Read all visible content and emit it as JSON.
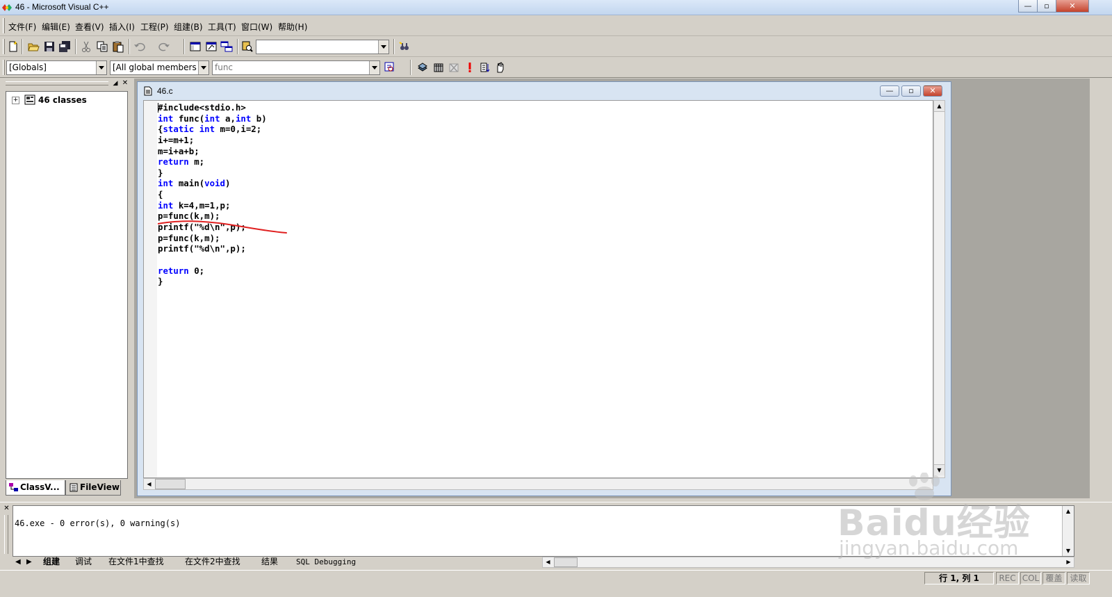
{
  "window": {
    "title": "46 - Microsoft Visual C++",
    "controls": {
      "minimize": "—",
      "maximize": "▫",
      "close": "✕"
    }
  },
  "menu": [
    {
      "label": "文件(F)"
    },
    {
      "label": "编辑(E)"
    },
    {
      "label": "查看(V)"
    },
    {
      "label": "插入(I)"
    },
    {
      "label": "工程(P)"
    },
    {
      "label": "组建(B)"
    },
    {
      "label": "工具(T)"
    },
    {
      "label": "窗口(W)"
    },
    {
      "label": "帮助(H)"
    }
  ],
  "toolbar": {
    "find_combo_value": "",
    "icons": [
      "new-file-icon",
      "open-folder-icon",
      "save-icon",
      "save-all-icon",
      "cut-icon",
      "copy-icon",
      "paste-icon",
      "undo-icon",
      "redo-icon",
      "workspace-icon",
      "output-icon",
      "window-list-icon",
      "find-in-files-icon",
      "find-icon"
    ]
  },
  "wizardbar": {
    "class_combo": "[Globals]",
    "filter_combo": "[All global members",
    "member_combo": "func",
    "icons": [
      "wizard-action-icon",
      "compile-icon",
      "build-icon",
      "stop-build-icon",
      "execute-icon",
      "insert-breakpoint-icon",
      "go-icon"
    ]
  },
  "workspace": {
    "tree_root": "46 classes",
    "tabs": [
      {
        "label": "ClassV..."
      },
      {
        "label": "FileView"
      }
    ]
  },
  "editor": {
    "filename": "46.c",
    "code": [
      [
        {
          "t": "#include<stdio.h>",
          "k": 0
        }
      ],
      [
        {
          "t": "int",
          "k": 1
        },
        {
          "t": " func(",
          "k": 0
        },
        {
          "t": "int",
          "k": 1
        },
        {
          "t": " a,",
          "k": 0
        },
        {
          "t": "int",
          "k": 1
        },
        {
          "t": " b)",
          "k": 0
        }
      ],
      [
        {
          "t": "{",
          "k": 0
        },
        {
          "t": "static",
          "k": 1
        },
        {
          "t": " ",
          "k": 0
        },
        {
          "t": "int",
          "k": 1
        },
        {
          "t": " m=0,i=2;",
          "k": 0
        }
      ],
      [
        {
          "t": "i+=m+1;",
          "k": 0
        }
      ],
      [
        {
          "t": "m=i+a+b;",
          "k": 0
        }
      ],
      [
        {
          "t": "return",
          "k": 1
        },
        {
          "t": " m;",
          "k": 0
        }
      ],
      [
        {
          "t": "}",
          "k": 0
        }
      ],
      [
        {
          "t": "int",
          "k": 1
        },
        {
          "t": " main(",
          "k": 0
        },
        {
          "t": "void",
          "k": 1
        },
        {
          "t": ")",
          "k": 0
        }
      ],
      [
        {
          "t": "{",
          "k": 0
        }
      ],
      [
        {
          "t": "int",
          "k": 1
        },
        {
          "t": " k=4,m=1,p;",
          "k": 0
        }
      ],
      [
        {
          "t": "p=func(k,m);",
          "k": 0
        }
      ],
      [
        {
          "t": "printf(\"%d\\n\",p);",
          "k": 0
        }
      ],
      [
        {
          "t": "p=func(k,m);",
          "k": 0
        }
      ],
      [
        {
          "t": "printf(\"%d\\n\",p);",
          "k": 0
        }
      ],
      [
        {
          "t": "",
          "k": 0
        }
      ],
      [
        {
          "t": "return",
          "k": 1
        },
        {
          "t": " 0;",
          "k": 0
        }
      ],
      [
        {
          "t": "}",
          "k": 0
        }
      ]
    ]
  },
  "output": {
    "text": "46.exe - 0 error(s), 0 warning(s)",
    "tabs": [
      {
        "label": "组建"
      },
      {
        "label": "调试"
      },
      {
        "label": "在文件1中查找"
      },
      {
        "label": "在文件2中查找"
      },
      {
        "label": "结果"
      },
      {
        "label": "SQL Debugging"
      }
    ]
  },
  "statusbar": {
    "position": "行 1, 列 1",
    "indicators": [
      "REC",
      "COL",
      "覆盖",
      "读取"
    ]
  },
  "watermark": {
    "brand": "Baidu经验",
    "url": "jingyan.baidu.com"
  }
}
